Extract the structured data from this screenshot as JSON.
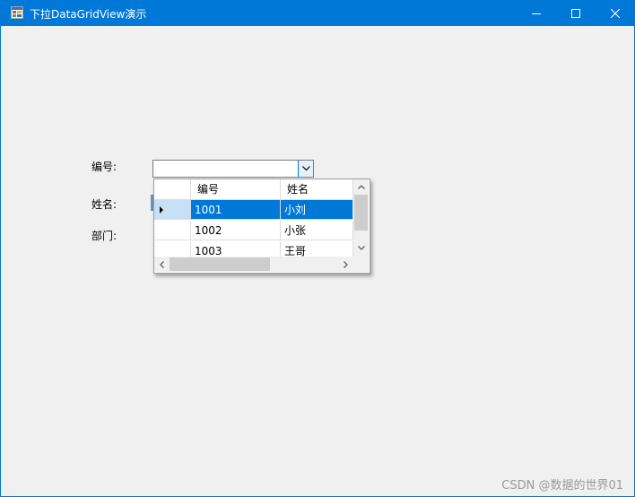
{
  "window": {
    "title": "下拉DataGridView演示"
  },
  "form": {
    "label_id": "编号:",
    "label_name": "姓名:",
    "label_dept": "部门:",
    "combo_value": ""
  },
  "dropdown_grid": {
    "columns": [
      "编号",
      "姓名"
    ],
    "rows": [
      {
        "id": "1001",
        "name": "小刘",
        "selected": true
      },
      {
        "id": "1002",
        "name": "小张",
        "selected": false
      },
      {
        "id": "1003",
        "name": "王哥",
        "selected": false
      }
    ]
  },
  "watermark": "CSDN @数据的世界01",
  "colors": {
    "title_bar": "#0078d7",
    "selection": "#0078d7",
    "row_header_selected": "#c6e0f5",
    "background": "#f0f0f0"
  },
  "icons": [
    "app-icon",
    "minimize-icon",
    "maximize-icon",
    "close-icon",
    "dropdown-arrow-icon",
    "current-row-indicator-icon",
    "scroll-up-icon",
    "scroll-down-icon",
    "scroll-left-icon",
    "scroll-right-icon"
  ]
}
